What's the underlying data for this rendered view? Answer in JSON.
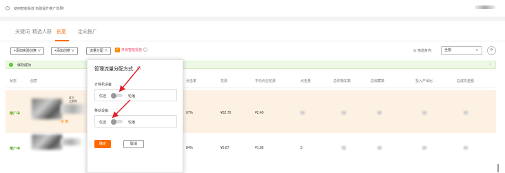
{
  "tipbar": {
    "text": "使用智能投放 有助提升推广效果！"
  },
  "tabs": [
    {
      "label": "关键词",
      "active": false
    },
    {
      "label": "精选人群",
      "active": false
    },
    {
      "label": "创意",
      "active": true
    },
    {
      "label": "定向推广",
      "active": false
    }
  ],
  "toolbar": {
    "add_creative": "添加实验创意",
    "add_creative_alt": "添加创意",
    "traffic": "流量分配",
    "smart_label": "开启智能投放",
    "filter_label": "筛选条件:",
    "filter_value": "全部"
  },
  "message": {
    "text": "保存成功"
  },
  "table": {
    "headers": [
      "状态",
      "创意",
      "点击率",
      "花费",
      "平均点击花费",
      "点击量",
      "总购物车数",
      "总收藏数",
      "投入产出比",
      "总成交金额"
    ],
    "rows": [
      {
        "status": "推广中",
        "ctr": "67%",
        "cost": "¥52.70",
        "avg_cost": "¥2.40",
        "clicks": "",
        "snippet": "这大\n之前的",
        "tag": "多 推"
      },
      {
        "status": "推广中",
        "ctr": "84%",
        "cost": "¥5.87",
        "avg_cost": "¥1.86",
        "clicks": "3",
        "snippet": "",
        "tag": ""
      }
    ]
  },
  "popup": {
    "title": "管理流量分配方式",
    "pc_label": "计算机设备:",
    "mobile_label": "移动设备:",
    "left_option": "优选",
    "right_option": "轮播",
    "ok": "确定",
    "cancel": "取消"
  },
  "colors": {
    "accent": "#ff6a00",
    "success": "#52c41a",
    "annotation": "#e0202a"
  }
}
